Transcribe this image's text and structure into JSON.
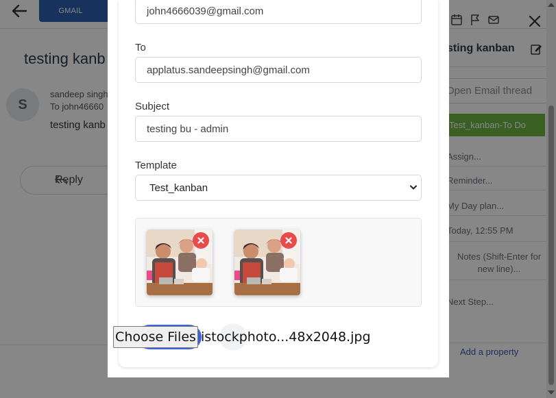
{
  "header": {
    "tab_label": "GMAIL"
  },
  "thread": {
    "title": "testing kanb",
    "avatar_initial": "S",
    "sender": "sandeep singh",
    "to_line": "To john46660",
    "snippet": "testing kanb",
    "reply_label": "Reply"
  },
  "side_panel": {
    "title": "sting kanban",
    "open_thread_label": "Open Email thread",
    "stage_label": "Test_kanban-To Do",
    "fields": {
      "assign": "Assign...",
      "reminder": "Reminder...",
      "day_plan": "My Day plan...",
      "date": "Today, 12:55 PM",
      "notes_line1": "Notes (Shift-Enter for",
      "notes_line2": "new line)...",
      "next_step": "Next Step..."
    },
    "add_property_label": "Add a property"
  },
  "form": {
    "from_value": "john4666039@gmail.com",
    "to_label": "To",
    "to_value": "applatus.sandeepsingh@gmail.com",
    "subject_label": "Subject",
    "subject_value": "testing bu - admin",
    "template_label": "Template",
    "template_value": "Test_kanban",
    "choose_files_label": "Choose Files",
    "file_name": "istockphoto...48x2048.jpg",
    "attachments": [
      {
        "icon": "photo-family-cooking",
        "remove_icon": "close-icon"
      },
      {
        "icon": "photo-family-cooking",
        "remove_icon": "close-icon"
      }
    ]
  },
  "colors": {
    "accent": "#2c5fb0",
    "stage_green": "#6db443",
    "remove_red": "#e94a4a",
    "overlay": "rgba(0,0,0,0.47)"
  }
}
